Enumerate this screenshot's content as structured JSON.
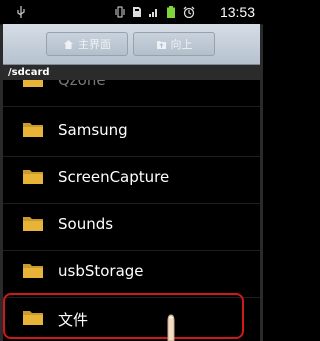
{
  "statusbar": {
    "time": "13:53",
    "icons": [
      "usb-icon",
      "vibrate-icon",
      "sd-card-icon",
      "signal-icon",
      "battery-icon",
      "alarm-icon"
    ]
  },
  "toolbar": {
    "home_label": "主界面",
    "up_label": "向上"
  },
  "path": "/sdcard",
  "files": [
    {
      "name": "Qzone",
      "partial": true
    },
    {
      "name": "Samsung"
    },
    {
      "name": "ScreenCapture"
    },
    {
      "name": "Sounds"
    },
    {
      "name": "usbStorage"
    },
    {
      "name": "文件",
      "highlighted": true
    }
  ],
  "colors": {
    "highlight": "#d01818",
    "folder": "#e8b437",
    "toolbar": "#c5ced8"
  }
}
